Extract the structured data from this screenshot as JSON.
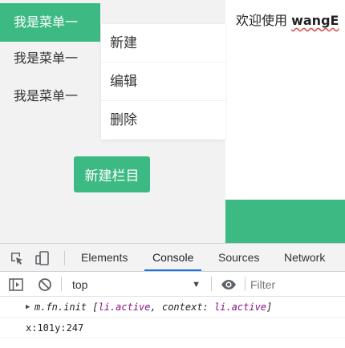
{
  "sidebar": {
    "items": [
      {
        "label": "我是菜单一",
        "active": true
      },
      {
        "label": "我是菜单一",
        "active": false
      },
      {
        "label": "我是菜单一",
        "active": false
      }
    ],
    "context_menu": {
      "items": [
        "新建",
        "编辑",
        "删除"
      ]
    },
    "new_column_button": "新建栏目"
  },
  "editor": {
    "prefix": "欢迎使用 ",
    "brand": "wangE"
  },
  "colors": {
    "accent": "#3dba83",
    "devtools_active_tab": "#1a73e8"
  },
  "devtools": {
    "tabs": [
      "Elements",
      "Console",
      "Sources",
      "Network"
    ],
    "active_tab": "Console",
    "icons": [
      "inspect-element-icon",
      "device-toolbar-icon"
    ],
    "toolbar": {
      "context": "top",
      "filter_placeholder": "Filter",
      "icons": [
        "sidebar-toggle-icon",
        "clear-console-icon",
        "eye-icon"
      ]
    },
    "console": {
      "entry1": {
        "prefix": "m.fn.init [",
        "item": "li.active",
        "sep": ", ",
        "key": "context",
        "colon": ": ",
        "value": "li.active",
        "suffix": "]"
      },
      "entry2": "x:101y:247"
    }
  }
}
